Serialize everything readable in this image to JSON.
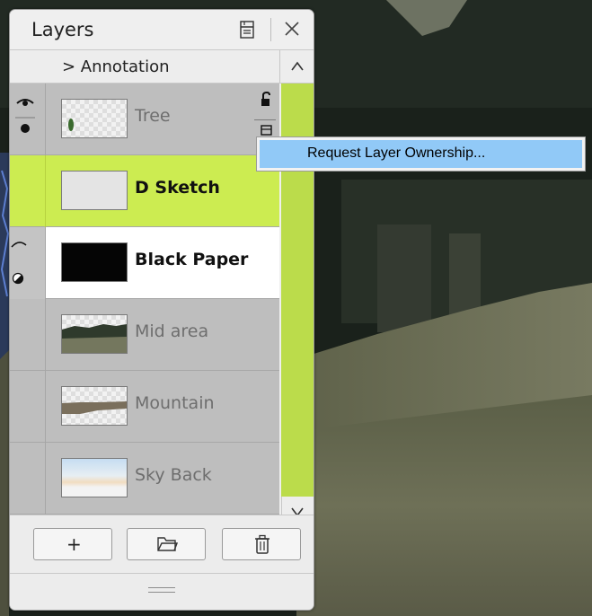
{
  "panel": {
    "title": "Layers",
    "annotation_row": "> Annotation",
    "icons": {
      "menu": "layer-menu-icon",
      "close": "close-icon",
      "scroll_up": "chevron-up-icon",
      "scroll_down": "chevron-down-icon",
      "add": "plus-icon",
      "group": "folder-icon",
      "delete": "trash-icon",
      "resize": "resize-grip-icon"
    },
    "accent_color": "#ccec51",
    "layers": [
      {
        "name": "Tree",
        "state": "locked-other-owner"
      },
      {
        "name": "D Sketch",
        "state": "selected"
      },
      {
        "name": "Black Paper",
        "state": "active"
      },
      {
        "name": "Mid area",
        "state": "normal"
      },
      {
        "name": "Mountain",
        "state": "normal"
      },
      {
        "name": "Sky Back",
        "state": "normal"
      }
    ],
    "add_label": "+"
  },
  "context_menu": {
    "items": [
      {
        "label": "Request Layer Ownership...",
        "highlighted": true
      }
    ],
    "highlight_color": "#91c9f7"
  }
}
